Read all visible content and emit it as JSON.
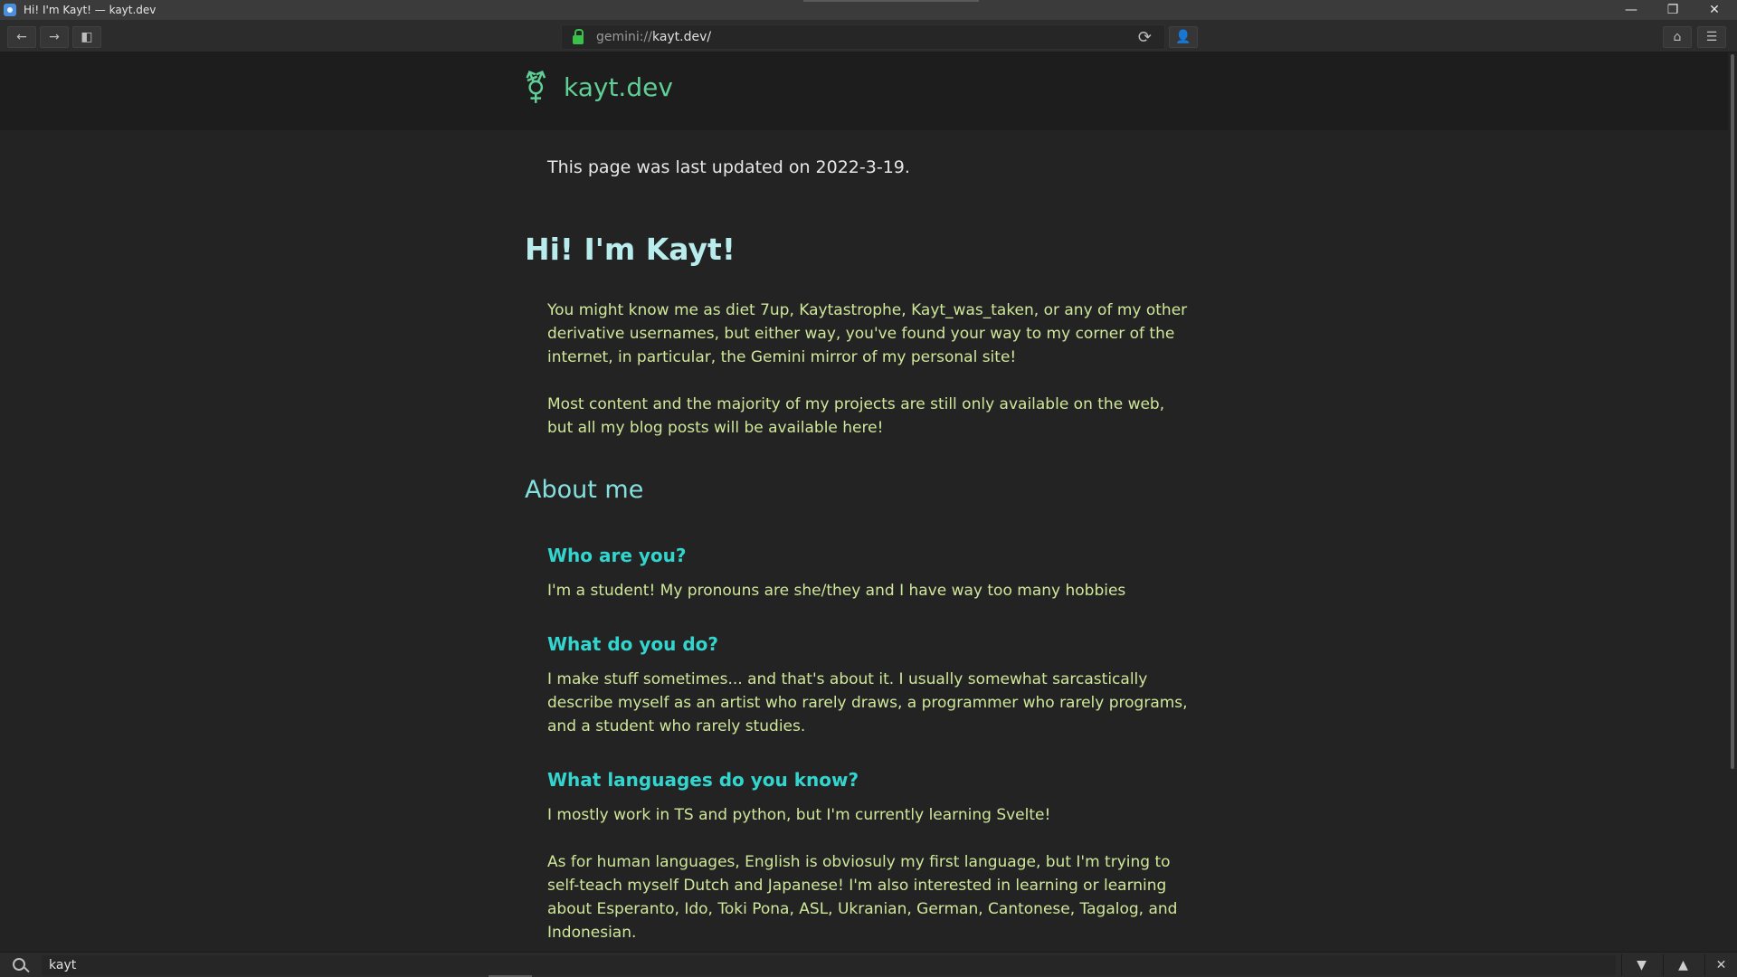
{
  "window": {
    "title": "Hi! I'm Kayt! — kayt.dev",
    "controls": {
      "minimize": "—",
      "restore": "❐",
      "close": "✕"
    }
  },
  "toolbar": {
    "back": "←",
    "forward": "→",
    "sidebar": "◧",
    "url_scheme": "gemini://",
    "url_host": "kayt.dev/",
    "reload": "⟳",
    "identity": "👤",
    "home": "⌂",
    "menu": "☰"
  },
  "site": {
    "logo_glyph": "⚧",
    "name": "kayt.dev"
  },
  "page": {
    "updated": "This page was last updated on 2022-3-19.",
    "heading": "Hi! I'm Kayt!",
    "intro1": "You might know me as diet 7up, Kaytastrophe, Kayt_was_taken, or any of my other derivative usernames, but either way, you've found your way to my corner of the internet, in particular, the Gemini mirror of my personal site!",
    "intro2": "Most content and the majority of my projects are still only available on the web, but all my blog posts will be available here!",
    "about_heading": "About me",
    "faq": [
      {
        "q": "Who are you?",
        "a": "I'm a student! My pronouns are she/they and I have way too many hobbies"
      },
      {
        "q": "What do you do?",
        "a": "I make stuff sometimes... and that's about it. I usually somewhat sarcastically describe myself as an artist who rarely draws, a programmer who rarely programs, and a student who rarely studies."
      },
      {
        "q": "What languages do you know?",
        "a": "I mostly work in TS and python, but I'm currently learning Svelte!"
      }
    ],
    "languages_human": "As for human languages, English is obviosuly my first language, but I'm trying to self-teach myself Dutch and Japanese! I'm also interested in learning or learning about Esperanto, Ido, Toki Pona, ASL, Ukranian, German, Cantonese, Tagalog, and Indonesian."
  },
  "findbar": {
    "query": "kayt",
    "next": "▼",
    "prev": "▲",
    "close": "✕"
  },
  "colors": {
    "accent_green": "#5fcf96",
    "body_text": "#cfe79a",
    "heading_cyan": "#33d6cf",
    "background": "#232323"
  }
}
